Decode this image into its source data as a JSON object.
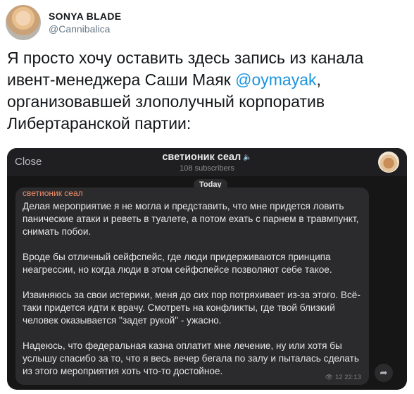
{
  "tweet": {
    "display_name": "SONYA BLADE",
    "handle": "@Cannibalica",
    "text_before": "Я просто хочу оставить здесь запись из канала ивент-менеджера Саши Маяк ",
    "mention": "@oymayak",
    "text_after": ", организовавшей злополучный корпоратив Либертаранской партии:"
  },
  "telegram": {
    "close_label": "Close",
    "channel_title": "светионик сеал",
    "mute_icon": "🔈",
    "subscribers": "108 subscribers",
    "date_label": "Today",
    "message": {
      "author": "светионик сеал",
      "paragraphs": [
        "Делая мероприятие я не могла и представить, что мне придется ловить панические атаки и реветь в туалете, а потом ехать с парнем в травмпункт, снимать побои.",
        "Вроде бы отличный сейфспейс, где люди придерживаются принципа неагрессии, но когда люди в этом сейфспейсе позволяют себе такое.",
        "Извиняюсь за свои истерики, меня до сих пор потряхивает из-за этого. Всё-таки придется идти к врачу. Смотреть на конфликты, где твой близкий человек оказывается \"задет рукой\" - ужасно.",
        "Надеюсь, что федеральная казна оплатит мне лечение, ну или хотя бы услышу спасибо за то, что я весь вечер бегала по залу и пыталась сделать из этого мероприятия хоть что-то достойное."
      ],
      "views_icon": "👁",
      "time": "12 22:13"
    },
    "share_icon": "➦"
  },
  "colors": {
    "mention": "#1b95e0",
    "telegram_bg": "#161617",
    "bubble_bg": "#2b2b2d",
    "author_name": "#f08c6a"
  }
}
